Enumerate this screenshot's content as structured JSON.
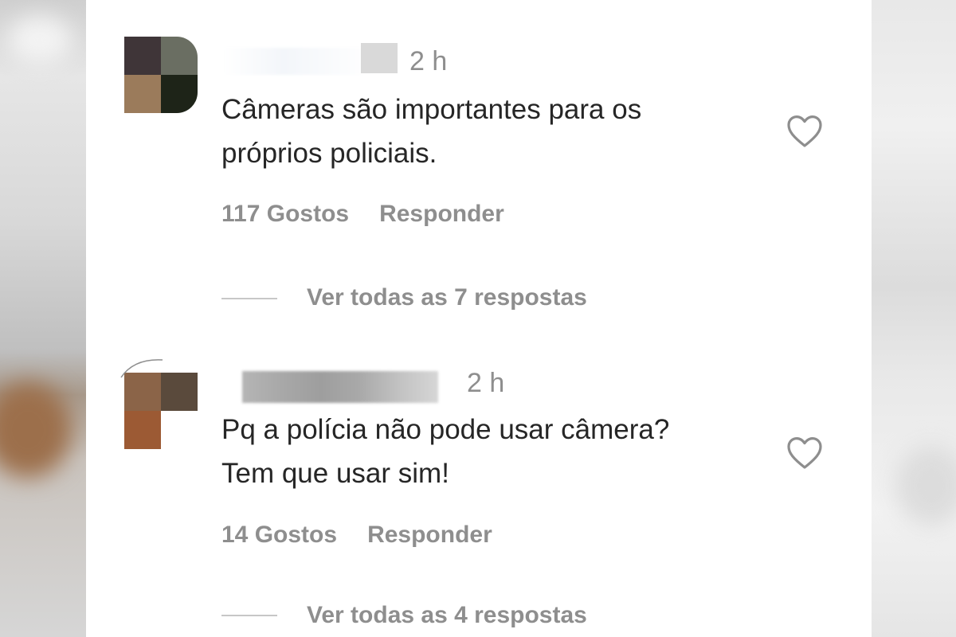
{
  "comments": [
    {
      "time": "2 h",
      "text": "Câmeras são importantes para os\npróprios policiais.",
      "likes": "117 Gostos",
      "reply_label": "Responder",
      "view_replies": "Ver todas as 7 respostas",
      "like_icon": "heart-outline-icon"
    },
    {
      "time": "2 h",
      "text": "Pq a polícia não pode usar câmera?\nTem que usar sim!",
      "likes": "14 Gostos",
      "reply_label": "Responder",
      "view_replies": "Ver todas as 4 respostas",
      "like_icon": "heart-outline-icon"
    }
  ],
  "colors": {
    "text_primary": "#262626",
    "text_secondary": "#8e8e8e",
    "background": "#ffffff"
  }
}
